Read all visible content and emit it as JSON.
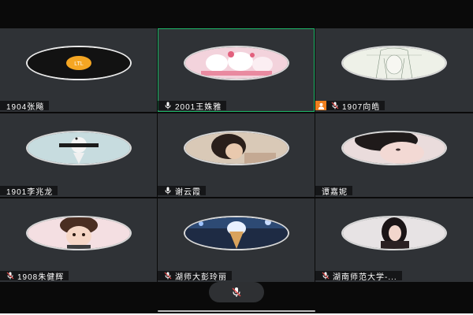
{
  "colors": {
    "tile_bg": "#2f3236",
    "active_border": "#1fb86a",
    "host_badge": "#f07f1d",
    "screen_bg": "#0a0a0a"
  },
  "participants": [
    {
      "name": "1904张飚",
      "avatar": "ltl-logo-avatar",
      "mic": false,
      "host": false,
      "active": false
    },
    {
      "name": "2001王姝雅",
      "avatar": "hello-kitty-avatar",
      "mic": true,
      "host": false,
      "active": true
    },
    {
      "name": "1907向皓",
      "avatar": "sketch-girl-avatar",
      "mic": true,
      "host": true,
      "active": false
    },
    {
      "name": "1901李兆龙",
      "avatar": "cartoon-character-avatar",
      "mic": false,
      "host": false,
      "active": false
    },
    {
      "name": "谢云霞",
      "avatar": "girl-photo-avatar",
      "mic": true,
      "host": false,
      "active": false
    },
    {
      "name": "谭嘉妮",
      "avatar": "girl-closeup-avatar",
      "mic": false,
      "host": false,
      "active": false
    },
    {
      "name": "1908朱健辉",
      "avatar": "anime-boy-avatar",
      "mic": true,
      "host": false,
      "active": false
    },
    {
      "name": "湖师大彭玲丽",
      "avatar": "ice-cream-avatar",
      "mic": true,
      "host": false,
      "active": false
    },
    {
      "name": "湖南师范大学-...",
      "avatar": "girl-portrait-avatar",
      "mic": true,
      "host": false,
      "active": false
    }
  ],
  "avatar_text": {
    "ltl_logo": "LTL"
  },
  "toolbar": {
    "control_icon": "mic-muted-icon"
  }
}
